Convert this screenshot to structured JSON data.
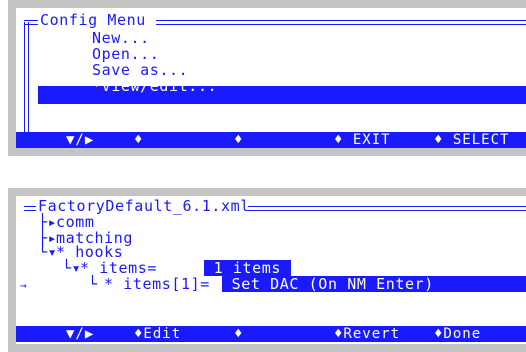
{
  "config_menu": {
    "title": "Config Menu",
    "items": [
      "New...",
      "Open...",
      "Save as...",
      "*View/edit..."
    ],
    "softkeys": [
      "▼/▶",
      "♦",
      "♦",
      "♦ EXIT",
      "♦ SELECT"
    ]
  },
  "editor": {
    "title": "FactoryDefault_6.1.xml",
    "tree": {
      "comm": "comm",
      "matching": "matching",
      "hooks": "* hooks",
      "items_label": "* items=",
      "items_value": " 1 items ",
      "item1_label": "* items[1]=",
      "item1_value": " Set DAC (On NM Enter)"
    },
    "softkeys": [
      "▼/▶",
      "♦Edit",
      "♦",
      "♦Revert",
      "♦Done"
    ]
  },
  "colors": {
    "accent": "#1a1aff",
    "panel": "#c4c4c4",
    "text_on_accent": "#ffffff"
  }
}
